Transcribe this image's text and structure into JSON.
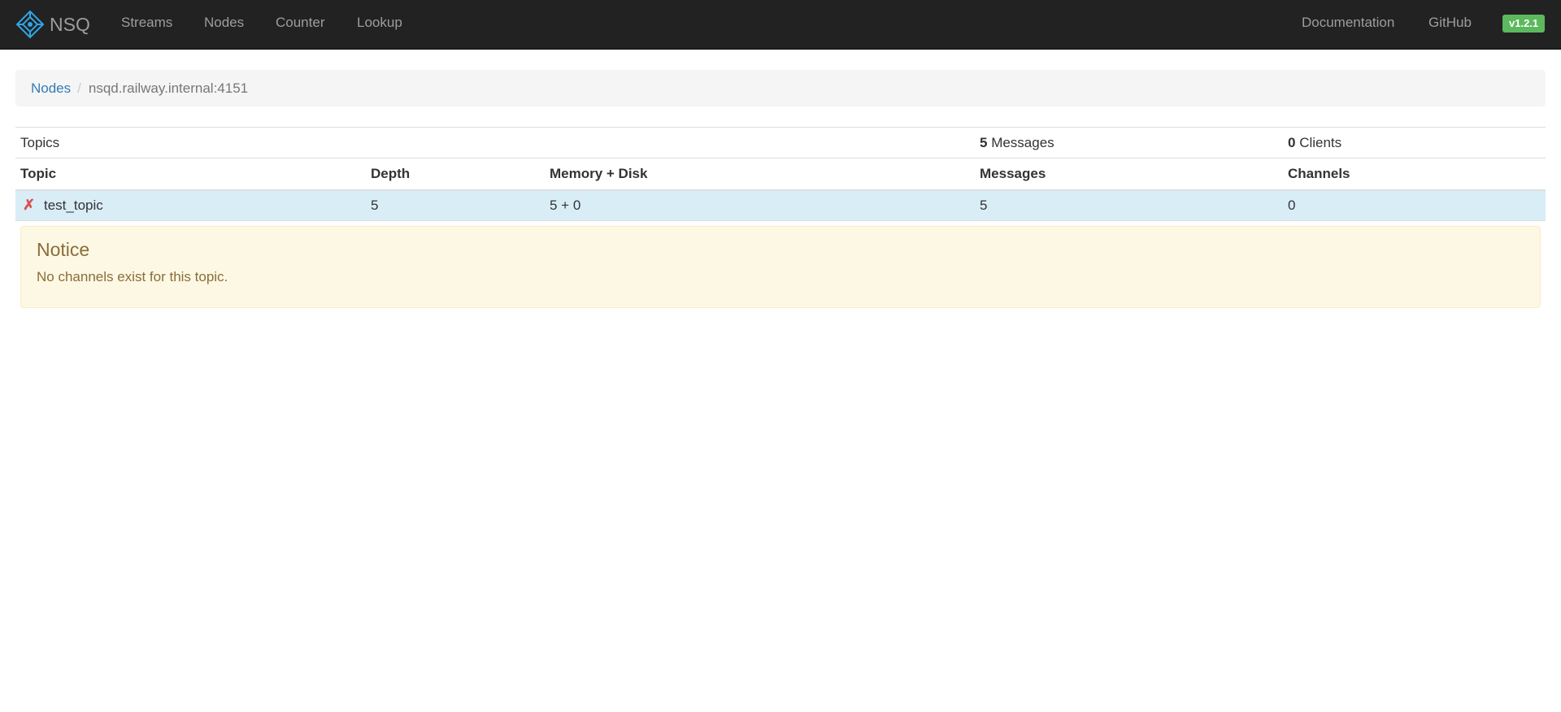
{
  "navbar": {
    "brand": "NSQ",
    "links": {
      "streams": "Streams",
      "nodes": "Nodes",
      "counter": "Counter",
      "lookup": "Lookup",
      "documentation": "Documentation",
      "github": "GitHub"
    },
    "version": "v1.2.1"
  },
  "breadcrumb": {
    "parent": "Nodes",
    "separator": "/",
    "current": "nsqd.railway.internal:4151"
  },
  "summary": {
    "label": "Topics",
    "messages_count": "5",
    "messages_label": " Messages",
    "clients_count": "0",
    "clients_label": " Clients"
  },
  "table": {
    "headers": [
      "Topic",
      "Depth",
      "Memory + Disk",
      "Messages",
      "Channels"
    ],
    "rows": [
      {
        "delete_icon": "✗",
        "topic": "test_topic",
        "depth": "5",
        "memory_disk": "5 + 0",
        "messages": "5",
        "channels": "0"
      }
    ]
  },
  "notice": {
    "title": "Notice",
    "message": "No channels exist for this topic."
  },
  "colors": {
    "navbar_bg": "#222222",
    "link": "#337ab7",
    "version_badge": "#5cb85c",
    "row_highlight": "#d9edf7",
    "notice_bg": "#fcf8e3",
    "notice_text": "#8a6d3b",
    "delete_icon": "#d9534f"
  }
}
